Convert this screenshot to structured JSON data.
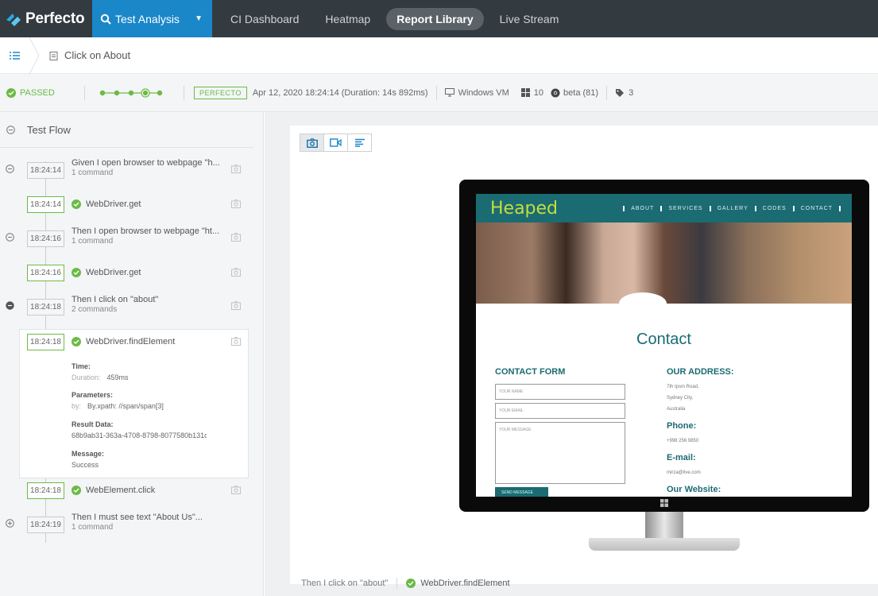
{
  "nav": {
    "brand": "Perfecto",
    "section": "Test Analysis",
    "tabs": [
      {
        "label": "CI Dashboard",
        "active": false
      },
      {
        "label": "Heatmap",
        "active": false
      },
      {
        "label": "Report Library",
        "active": true
      },
      {
        "label": "Live Stream",
        "active": false
      }
    ]
  },
  "breadcrumb": {
    "title": "Click on About"
  },
  "status": {
    "result": "PASSED",
    "tag": "PERFECTO",
    "datetime": "Apr 12, 2020 18:24:14 (Duration: 14s 892ms)",
    "platform": "Windows VM",
    "os_version": "10",
    "browser": "beta (81)",
    "tags_count": "3"
  },
  "flow": {
    "header": "Test Flow",
    "steps": [
      {
        "time": "18:24:14",
        "title": "Given I open browser to webpage \"h...",
        "sub": "1 command"
      },
      {
        "time": "18:24:14",
        "command": "WebDriver.get"
      },
      {
        "time": "18:24:16",
        "title": "Then I open browser to webpage \"ht...",
        "sub": "1 command"
      },
      {
        "time": "18:24:16",
        "command": "WebDriver.get"
      },
      {
        "time": "18:24:18",
        "title": "Then I click on \"about\"",
        "sub": "2 commands"
      },
      {
        "time": "18:24:18",
        "command": "WebDriver.findElement"
      },
      {
        "time": "18:24:18",
        "command": "WebElement.click"
      },
      {
        "time": "18:24:19",
        "title": "Then I must see text \"About Us\"...",
        "sub": "1 command"
      }
    ],
    "detail": {
      "time_label": "Time:",
      "duration_key": "Duration:",
      "duration_val": "459ms",
      "params_label": "Parameters:",
      "params_key": "by:",
      "params_val": "By.xpath: //span/span[3]",
      "result_label": "Result Data:",
      "result_val": "68b9ab31-363a-4708-8798-8077580b131c",
      "message_label": "Message:",
      "message_val": "Success"
    }
  },
  "viewer": {
    "bottom_step": "Then I click on \"about\"",
    "bottom_command": "WebDriver.findElement"
  },
  "website": {
    "logo": "Heaped",
    "nav": [
      "ABOUT",
      "SERVICES",
      "GALLERY",
      "CODES",
      "CONTACT"
    ],
    "heading": "Contact",
    "form_title": "CONTACT FORM",
    "name_ph": "YOUR NAME",
    "email_ph": "YOUR EMAIL",
    "message_ph": "YOUR MESSAGE",
    "send": "SEND MESSAGE",
    "address_title": "OUR ADDRESS:",
    "address_l1": "7th Ipsm Road,",
    "address_l2": "Sydney City,",
    "address_l3": "Australia",
    "phone_title": "Phone:",
    "phone_val": "+998 256 9850",
    "email_title": "E-mail:",
    "email_val": "mirza@live.com",
    "website_title": "Our Website:"
  },
  "colors": {
    "accent": "#1a87c9",
    "success": "#6cba45",
    "nav_bg": "#333a40",
    "site_teal": "#1a6b72"
  }
}
